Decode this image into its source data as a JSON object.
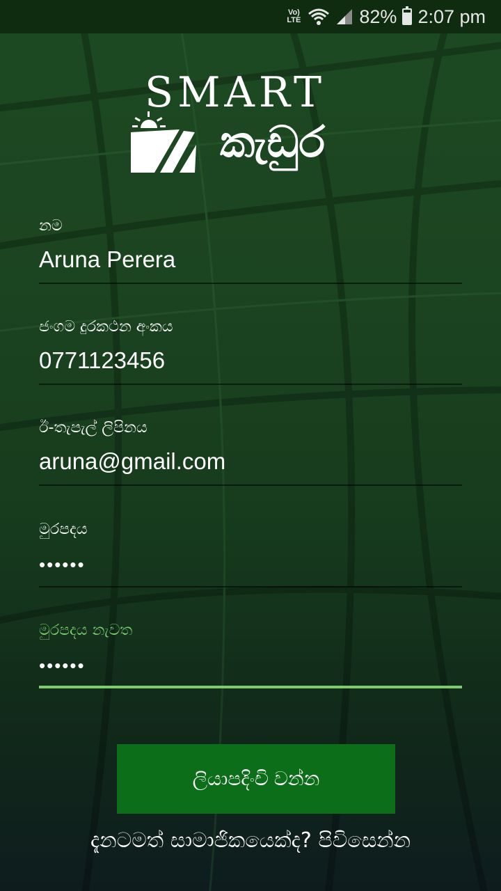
{
  "status_bar": {
    "volte": "Vo) LTE",
    "battery": "82%",
    "battery_level": 0.82,
    "time": "2:07 pm",
    "icons": [
      "volte-icon",
      "wifi-icon",
      "signal-icon",
      "battery-icon"
    ]
  },
  "logo": {
    "latin": "SMART",
    "sinhala": "කැඩුර",
    "icon": "farm-sun-icon"
  },
  "form": {
    "name_label": "නම",
    "name_value": "Aruna Perera",
    "phone_label": "ජංගම දුරකථන අංකය",
    "phone_value": "0771123456",
    "email_label": "ඊ-තැපැල් ලිපිනය",
    "email_value": "aruna@gmail.com",
    "password_label": "මුරපදය",
    "password_value": "••••••",
    "confirm_label": "මුරපදය නැවත",
    "confirm_value": "••••••"
  },
  "actions": {
    "register_label": "ලියාපදිංචි වන්න",
    "login_link": "දැනටමත් සාමාජිකයෙක්ද? පිවිසෙන්න"
  },
  "colors": {
    "accent": "#7ecb6e",
    "button": "#0d6e1a",
    "status_bar": "#0f2b10"
  }
}
